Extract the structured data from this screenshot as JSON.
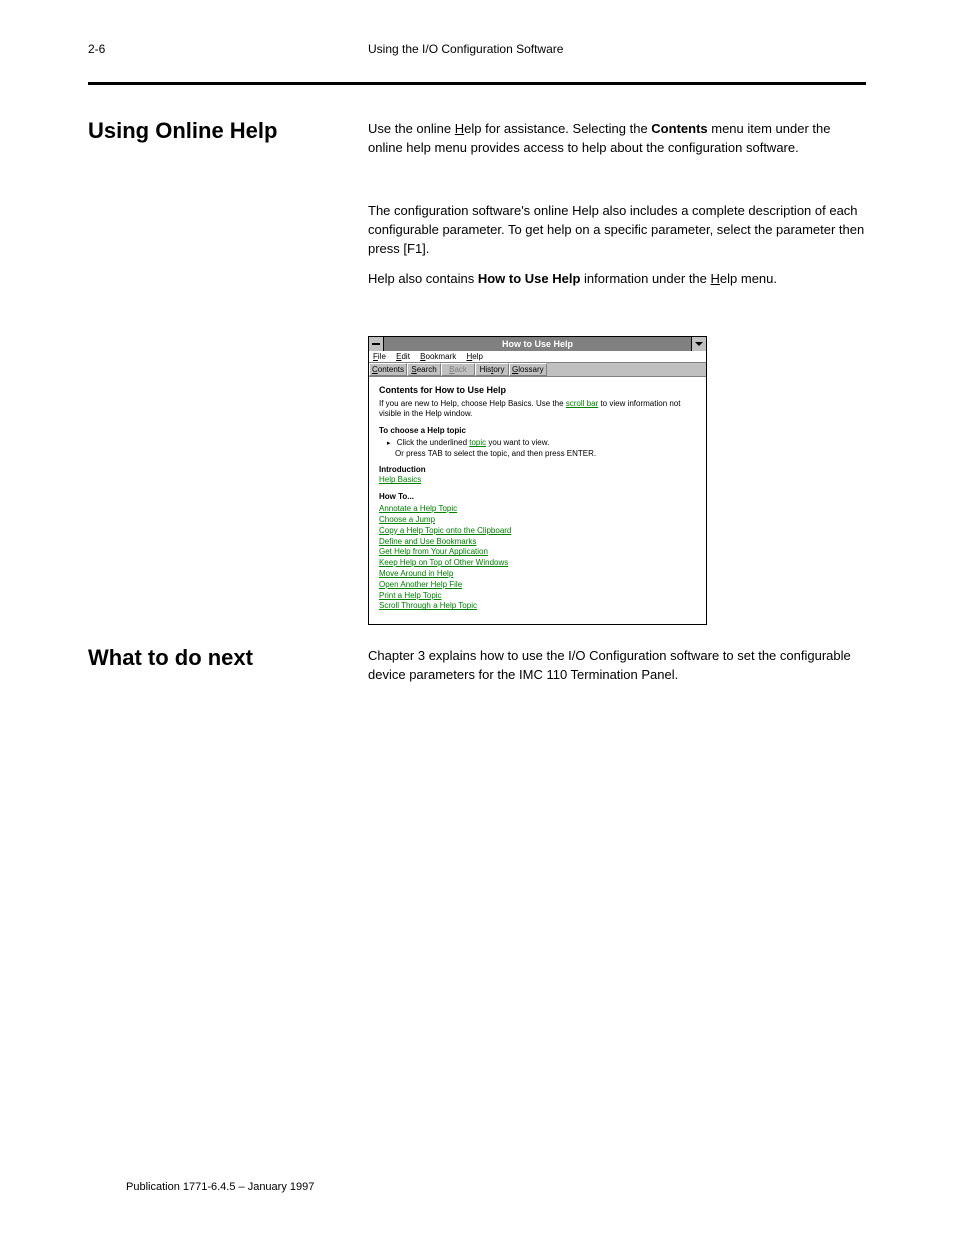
{
  "page_number": "2-6",
  "chapter_title": "Using the I/O Configuration Software",
  "heading_online_help": "Using Online Help",
  "heading_what_next": "What to do next",
  "paragraphs": {
    "p1_pre": "Use the online ",
    "p1_help_u": "H",
    "p1_help_rest": "elp",
    "p1_mid": " for assistance. Selecting the ",
    "p1_contents": "Contents",
    "p1_post": " menu item under the online help menu provides access to help about the configuration software.",
    "p2": "The configuration software's online Help also includes a complete description of each configurable parameter. To get help on a specific parameter, select the parameter then press [F1].",
    "p3_pre": "Help also contains ",
    "p3_how": "How to Use Help",
    "p3_mid": " information under the ",
    "p3_help_u": "H",
    "p3_help_rest": "elp",
    "p3_post": " menu.",
    "p4": "Chapter 3 explains how to use the I/O Configuration software to set the configurable device parameters for the IMC 110 Termination Panel."
  },
  "helpwin": {
    "title": "How to Use Help",
    "menu": {
      "file": "File",
      "edit": "Edit",
      "bookmark": "Bookmark",
      "help": "Help"
    },
    "toolbar": {
      "contents": "Contents",
      "search": "Search",
      "back": "Back",
      "history": "History",
      "glossary": "Glossary"
    },
    "content": {
      "heading": "Contents for How to Use Help",
      "intro_pre": "If you are new to Help, choose Help Basics. Use the ",
      "intro_link": "scroll bar",
      "intro_post": " to view information not visible in the Help window.",
      "choose_hdr": "To choose a Help topic",
      "choose_l1_pre": "Click the underlined ",
      "choose_l1_link": "topic",
      "choose_l1_post": " you want to view.",
      "choose_l2": "Or press TAB to select the topic, and then press ENTER.",
      "intro_hdr": "Introduction",
      "help_basics": "Help Basics",
      "howto_hdr": "How To...",
      "howto_items": [
        "Annotate a Help Topic",
        "Choose a Jump",
        "Copy a Help Topic onto the Clipboard",
        "Define and Use Bookmarks",
        "Get Help from Your Application",
        "Keep Help on Top of Other Windows",
        "Move Around in Help",
        "Open Another Help File",
        "Print a Help Topic",
        "Scroll Through a Help Topic"
      ]
    }
  },
  "footer": "Publication 1771-6.4.5 – January 1997"
}
